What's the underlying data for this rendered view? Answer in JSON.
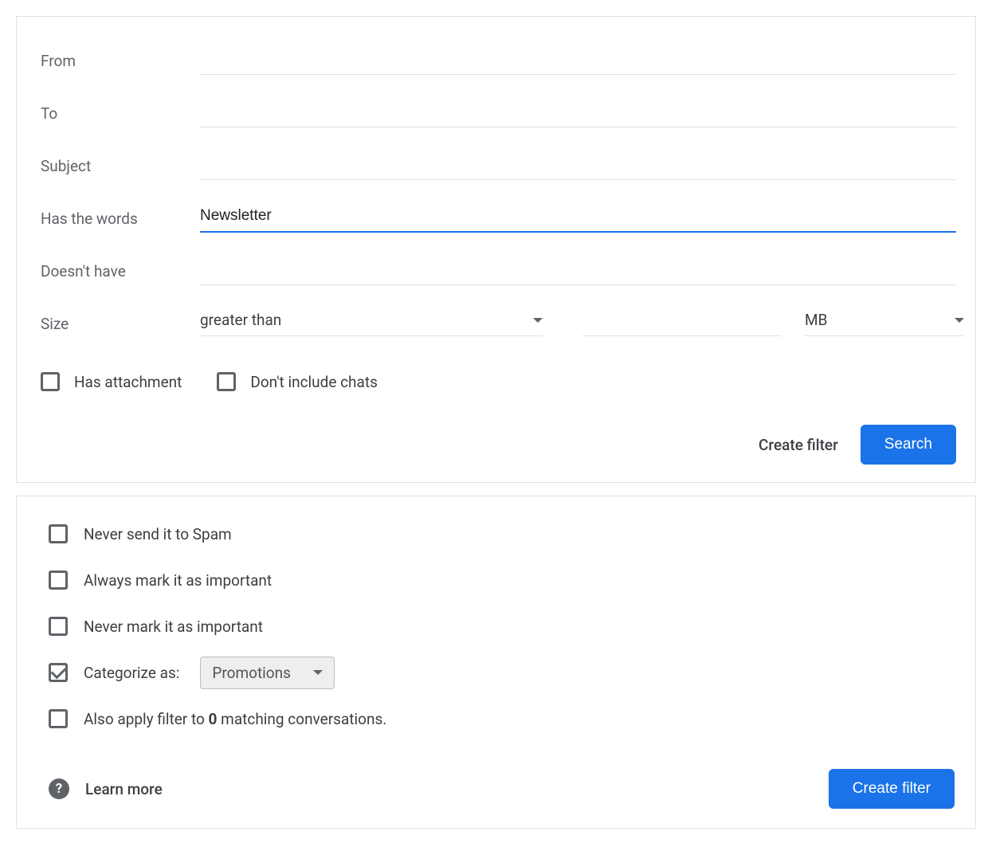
{
  "search": {
    "from_label": "From",
    "to_label": "To",
    "subject_label": "Subject",
    "has_words_label": "Has the words",
    "has_words_value": "Newsletter",
    "doesnt_have_label": "Doesn't have",
    "size_label": "Size",
    "size_operator": "greater than",
    "size_unit": "MB",
    "has_attachment_label": "Has attachment",
    "dont_include_chats_label": "Don't include chats",
    "create_filter_label": "Create filter",
    "search_button_label": "Search"
  },
  "options": {
    "never_spam": "Never send it to Spam",
    "always_important": "Always mark it as important",
    "never_important": "Never mark it as important",
    "categorize_label": "Categorize as:",
    "categorize_value": "Promotions",
    "apply_prefix": "Also apply filter to ",
    "apply_count": "0",
    "apply_suffix": " matching conversations.",
    "learn_more_label": "Learn more",
    "create_filter_label": "Create filter"
  }
}
